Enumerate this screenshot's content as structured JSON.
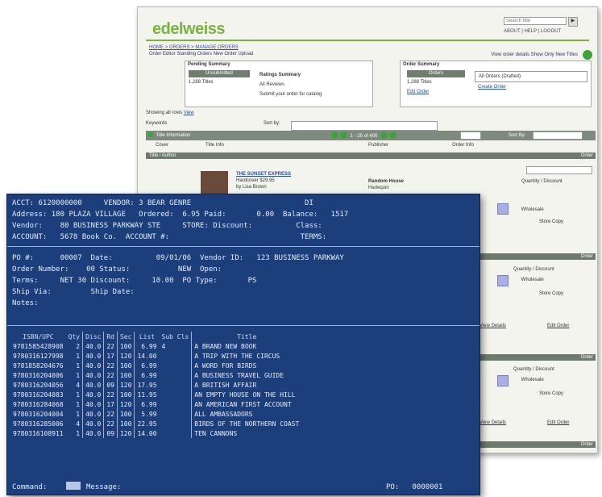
{
  "website": {
    "logo": "edelweiss",
    "search_placeholder": "Search title",
    "search_button": "▶",
    "top_links": "ABOUT  |  HELP  |  LOGOUT",
    "breadcrumb_line1": "HOME > ORDERS > MANAGE ORDERS",
    "breadcrumb_line2": "Order Editor   Standing Orders   New Order Upload",
    "right_crumb": "View order details  Show Only New Titles",
    "panel_left": {
      "title": "Pending Summary",
      "head_a": "Unsubmitted",
      "head_b": "Ratings Summary",
      "text_a": "1,288 Titles",
      "text_b": "All Reviews",
      "text_c": "Submit your order for catalog"
    },
    "panel_right": {
      "title": "Order Summary",
      "head_a": "Orders",
      "text_a": "1,288 Titles",
      "text_b": "Edit Order",
      "select_value": "All Orders (Drafted)",
      "link": "Create Order"
    },
    "rows_bar": "Showing all rows",
    "rows_link": "View",
    "field_label_a": "Keywords",
    "field_label_b": "Sort by:",
    "toolbar_label": "Title Information",
    "toolbar_count": "1 - 25 of 400",
    "toolbar_sort": "Sort By:",
    "col_cover": "Cover",
    "col_info": "Title Info",
    "col_pub": "Publisher",
    "col_order": "Order Info",
    "sect1": "Title / Author",
    "sect_right": "Order",
    "book_title": "THE SUNSET EXPRESS",
    "book_sub": "Hardcover  $29.95",
    "book_by": "by Lisa Brown",
    "pub_a": "Random House",
    "pub_b": "Harlequin",
    "side_title": "Quantity / Discount",
    "side_a": "Wholesale",
    "side_b": "Store Copy",
    "side_link": "Edit Order",
    "detail_link": "View Details"
  },
  "terminal": {
    "row1": "ACCT: 6120000000     VENDOR: 3 BEAR GENRE                          DI",
    "row2": "Address: 180 PLAZA VILLAGE   Ordered:  6.95 Paid:       0.00  Balance:   1517",
    "row3": "Vendor:    80 BUSINESS PARKWAY STE     STORE: Discount:          Class:",
    "row4": "ACCOUNT:   5678 Book Co.  ACCOUNT #:                              TERMS:",
    "row5": "PO #:      00007  Date:          09/01/06  Vendor ID:   123 BUSINESS PARKWAY",
    "row6": "Order Number:    00 Status:           NEW  Open:",
    "row7": "Terms:     NET 30 Discount:     10.00  PO Type:       PS",
    "row8": "Ship Via:         Ship Date:",
    "row9": "Notes:",
    "headers": [
      "ISBN/UPC",
      "Qty",
      "Disc",
      "Rd",
      "Sec",
      "List",
      "Sub Cls",
      "Title"
    ],
    "rows": [
      [
        "9781585428908",
        "2",
        "40.0",
        "22",
        "100",
        "6.99",
        "4",
        "A BRAND NEW BOOK"
      ],
      [
        "9780316127998",
        "1",
        "40.0",
        "17",
        "120",
        "14.00",
        "",
        "A TRIP WITH THE CIRCUS"
      ],
      [
        "9781858204676",
        "1",
        "40.0",
        "22",
        "100",
        "6.99",
        "",
        "A WORD FOR BIRDS"
      ],
      [
        "9780316204006",
        "1",
        "40.0",
        "22",
        "100",
        "6.99",
        "",
        "A BUSINESS TRAVEL GUIDE"
      ],
      [
        "9780316204056",
        "4",
        "40.0",
        "09",
        "120",
        "17.95",
        "",
        "A BRITISH AFFAIR"
      ],
      [
        "9780316204083",
        "1",
        "40.0",
        "22",
        "100",
        "11.95",
        "",
        "AN EMPTY HOUSE ON THE HILL"
      ],
      [
        "9780316284068",
        "1",
        "40.0",
        "17",
        "120",
        "6.99",
        "",
        "AN AMERICAN FIRST ACCOUNT"
      ],
      [
        "9780316204004",
        "1",
        "40.0",
        "22",
        "100",
        "5.99",
        "",
        "ALL AMBASSADORS"
      ],
      [
        "9780316285006",
        "4",
        "40.0",
        "22",
        "100",
        "22.95",
        "",
        "BIRDS OF THE NORTHERN COAST"
      ],
      [
        "9780316108911",
        "1",
        "40.0",
        "09",
        "120",
        "14.00",
        "",
        "TEN CANNONS"
      ]
    ],
    "command_label": "Command:",
    "message_label": "Message:",
    "bottom_right": "PO:   0000001"
  }
}
